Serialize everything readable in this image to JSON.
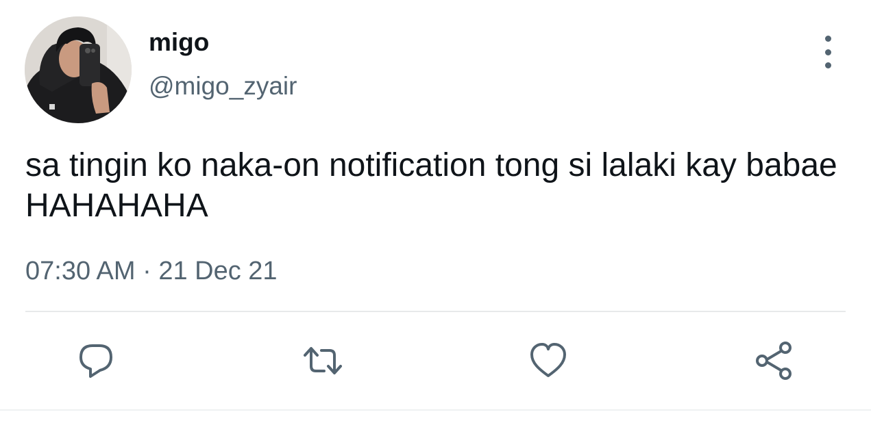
{
  "tweet": {
    "author": {
      "display_name": "migo",
      "handle": "@migo_zyair",
      "avatar": "avatar-photo"
    },
    "text": "sa tingin ko naka-on notification tong si lalaki kay babae HAHAHAHA",
    "time": "07:30 AM",
    "separator": "·",
    "date": "21 Dec 21"
  },
  "actions": [
    {
      "name": "reply",
      "icon": "speech-bubble-icon"
    },
    {
      "name": "retweet",
      "icon": "retweet-icon"
    },
    {
      "name": "like",
      "icon": "heart-icon"
    },
    {
      "name": "share",
      "icon": "share-icon"
    }
  ],
  "colors": {
    "text_primary": "#0f1419",
    "text_secondary": "#536471",
    "icon": "#536471",
    "divider": "#e7e9ea",
    "background": "#ffffff"
  }
}
